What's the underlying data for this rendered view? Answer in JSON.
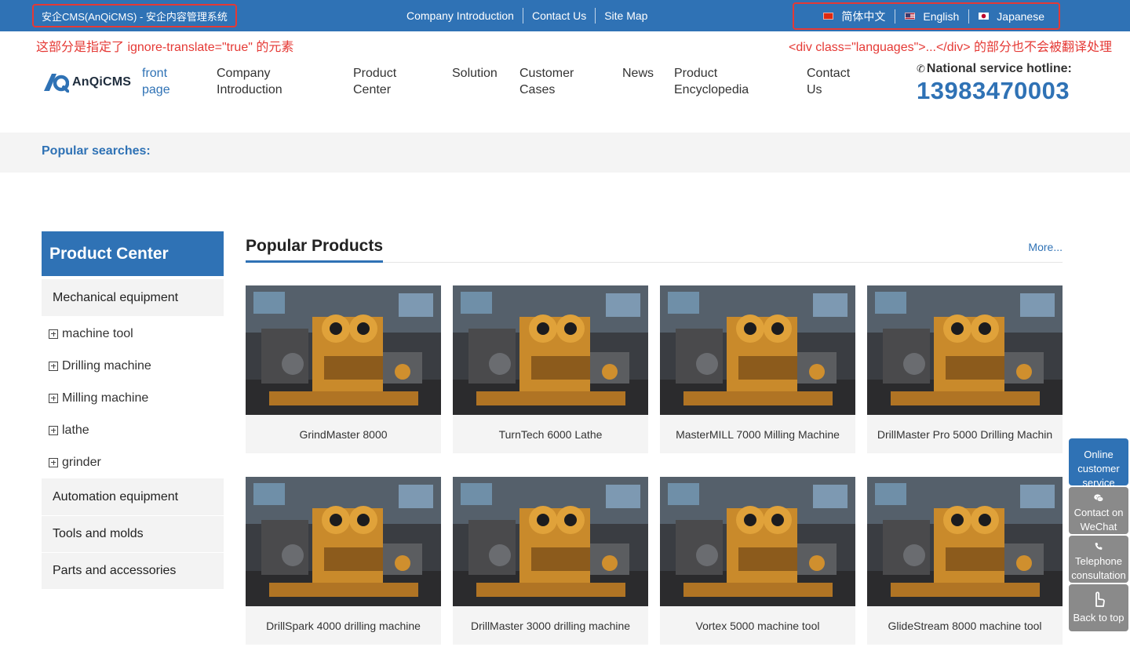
{
  "topbar": {
    "site_title": "安企CMS(AnQiCMS) - 安企内容管理系统",
    "links": [
      "Company Introduction",
      "Contact Us",
      "Site Map"
    ],
    "languages": [
      {
        "label": "简体中文",
        "flag": "cn-flag-icon"
      },
      {
        "label": "English",
        "flag": "us-flag-icon"
      },
      {
        "label": "Japanese",
        "flag": "jp-flag-icon"
      }
    ],
    "background": "#2f72b5",
    "highlight_color": "#e53935"
  },
  "annotations": {
    "left": "这部分是指定了 ignore-translate=\"true\" 的元素",
    "right": "<div class=\"languages\">...</div> 的部分也不会被翻译处理"
  },
  "header": {
    "logo_text": "AnQiCMS",
    "nav": [
      "front page",
      "Company Introduction",
      "Product Center",
      "Solution",
      "Customer Cases",
      "News",
      "Product Encyclopedia",
      "Contact Us"
    ],
    "hotline_label": "National service hotline:",
    "hotline_number": "13983470003"
  },
  "search": {
    "label": "Popular searches:"
  },
  "sidebar": {
    "title": "Product Center",
    "categories": [
      {
        "label": "Mechanical equipment",
        "children": [
          "machine tool",
          "Drilling machine",
          "Milling machine",
          "lathe",
          "grinder"
        ]
      },
      {
        "label": "Automation equipment",
        "children": []
      },
      {
        "label": "Tools and molds",
        "children": []
      },
      {
        "label": "Parts and accessories",
        "children": []
      }
    ]
  },
  "products": {
    "title": "Popular Products",
    "more": "More...",
    "items": [
      "GrindMaster 8000",
      "TurnTech 6000 Lathe",
      "MasterMILL 7000 Milling Machine",
      "DrillMaster Pro 5000 Drilling Machin",
      "DrillSpark 4000 drilling machine",
      "DrillMaster 3000 drilling machine",
      "Vortex 5000 machine tool",
      "GlideStream 8000 machine tool"
    ]
  },
  "float_tools": [
    {
      "label": "Online customer service",
      "icon": "headset-icon"
    },
    {
      "label": "Contact on WeChat",
      "icon": "wechat-icon"
    },
    {
      "label": "Telephone consultation",
      "icon": "phone-icon"
    },
    {
      "label": "Back to top",
      "icon": "pointer-up-icon"
    }
  ]
}
